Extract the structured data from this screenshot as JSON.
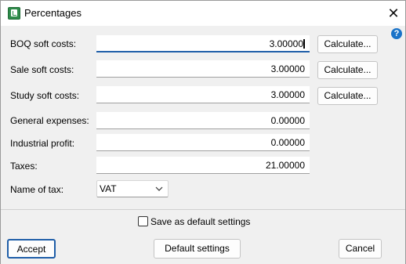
{
  "window": {
    "title": "Percentages",
    "close_glyph": "✕",
    "help_glyph": "?"
  },
  "fields": [
    {
      "label": "BOQ soft costs:",
      "value": "3.00000",
      "has_calculate": true,
      "focused": true
    },
    {
      "label": "Sale soft costs:",
      "value": "3.00000",
      "has_calculate": true,
      "focused": false
    },
    {
      "label": "Study soft costs:",
      "value": "3.00000",
      "has_calculate": true,
      "focused": false
    },
    {
      "label": "General expenses:",
      "value": "0.00000",
      "has_calculate": false,
      "focused": false
    },
    {
      "label": "Industrial profit:",
      "value": "0.00000",
      "has_calculate": false,
      "focused": false
    },
    {
      "label": "Taxes:",
      "value": "21.00000",
      "has_calculate": false,
      "focused": false
    }
  ],
  "calculate_label": "Calculate...",
  "tax_name": {
    "label": "Name of tax:",
    "selected": "VAT"
  },
  "save_default": {
    "label": "Save as default settings",
    "checked": false
  },
  "buttons": {
    "accept": "Accept",
    "default_settings": "Default settings",
    "cancel": "Cancel"
  },
  "icons": {
    "app": "spreadsheet-icon",
    "close": "close-icon",
    "help": "help-icon",
    "dropdown": "chevron-down-icon"
  },
  "colors": {
    "accent": "#1f5ea8",
    "help": "#1a73c8",
    "app_icon": "#2e8b4a"
  }
}
